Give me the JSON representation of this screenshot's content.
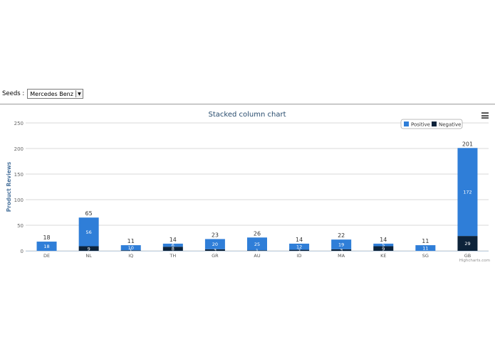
{
  "seeds": {
    "label": "Seeds :",
    "selected": "Mercedes Benz"
  },
  "credit": "Highcharts.com",
  "colors": {
    "positive": "#2f7ed8",
    "negative": "#0d233a",
    "title": "#274b6d",
    "axis_title": "#4d759e"
  },
  "chart_data": {
    "type": "bar",
    "stacked": true,
    "title": "Stacked column chart",
    "xlabel": "",
    "ylabel": "Product Reviews",
    "ylim": [
      0,
      250
    ],
    "yticks": [
      0,
      50,
      100,
      150,
      200,
      250
    ],
    "grid": true,
    "legend_position": "top-right",
    "categories": [
      "DE",
      "NL",
      "IQ",
      "TH",
      "GR",
      "AU",
      "ID",
      "MA",
      "KE",
      "SG",
      "GB"
    ],
    "series": [
      {
        "name": "Positive",
        "values": [
          18,
          56,
          10,
          6,
          20,
          25,
          12,
          19,
          5,
          11,
          172
        ]
      },
      {
        "name": "Negative",
        "values": [
          0,
          9,
          1,
          8,
          3,
          1,
          2,
          3,
          9,
          0,
          29
        ]
      }
    ],
    "totals": [
      18,
      65,
      11,
      14,
      23,
      26,
      14,
      22,
      14,
      11,
      201
    ]
  }
}
